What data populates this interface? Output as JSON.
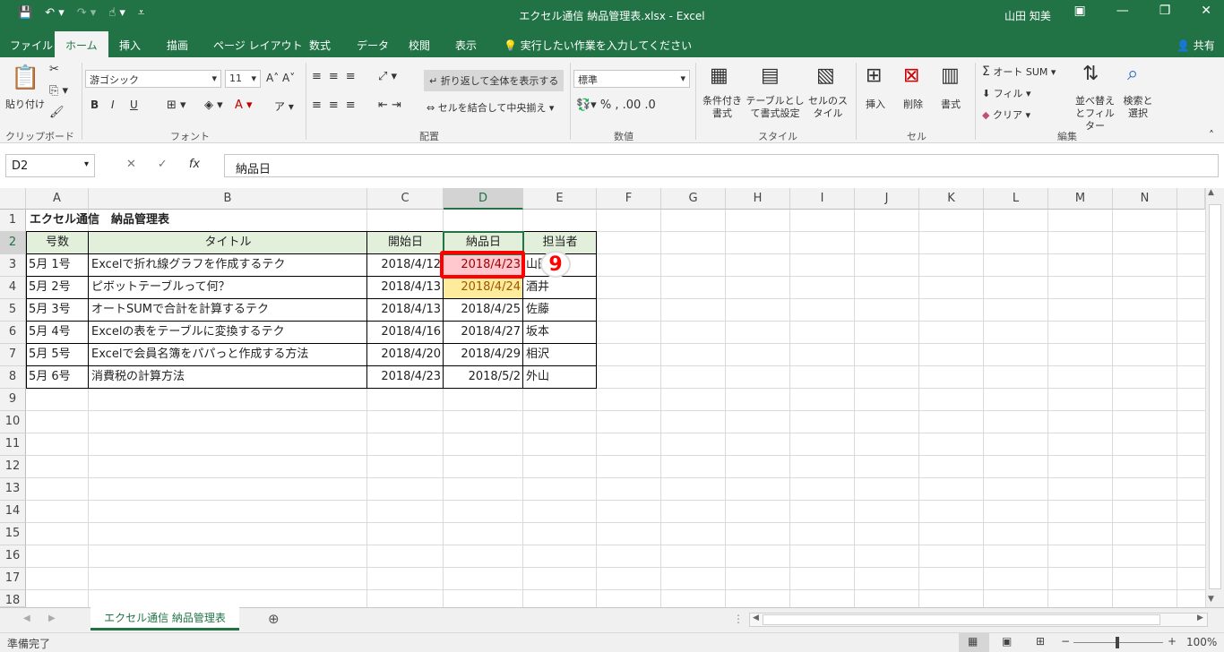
{
  "window": {
    "title": "エクセル通信 納品管理表.xlsx  -  Excel",
    "user": "山田 知美"
  },
  "tabs": [
    "ファイル",
    "ホーム",
    "挿入",
    "描画",
    "ページ レイアウト",
    "数式",
    "データ",
    "校閲",
    "表示",
    "実行したい作業を入力してください"
  ],
  "active_tab": "ホーム",
  "share_label": "共有",
  "ribbon": {
    "clipboard": {
      "paste": "貼り付け",
      "group": "クリップボード"
    },
    "font": {
      "name": "游ゴシック",
      "size": "11",
      "bold": "B",
      "italic": "I",
      "underline": "U",
      "group": "フォント"
    },
    "alignment": {
      "wrap": "折り返して全体を表示する",
      "merge": "セルを結合して中央揃え",
      "group": "配置"
    },
    "number": {
      "format": "標準",
      "group": "数値"
    },
    "styles": {
      "cond": "条件付き書式",
      "table": "テーブルとして書式設定",
      "cell": "セルのスタイル",
      "group": "スタイル"
    },
    "cells": {
      "insert": "挿入",
      "delete": "削除",
      "format": "書式",
      "group": "セル"
    },
    "editing": {
      "autosum": "オート SUM",
      "fill": "フィル",
      "clear": "クリア",
      "sort": "並べ替えとフィルター",
      "find": "検索と選択",
      "group": "編集"
    }
  },
  "formula_bar": {
    "name_box": "D2",
    "formula": "納品日"
  },
  "columns": [
    "A",
    "B",
    "C",
    "D",
    "E",
    "F",
    "G",
    "H",
    "I",
    "J",
    "K",
    "L",
    "M",
    "N"
  ],
  "rows": [
    "1",
    "2",
    "3",
    "4",
    "5",
    "6",
    "7",
    "8",
    "9",
    "10",
    "11",
    "12",
    "13",
    "14",
    "15",
    "16",
    "17",
    "18"
  ],
  "sheet": {
    "title": "エクセル通信　納品管理表",
    "headers": [
      "号数",
      "タイトル",
      "開始日",
      "納品日",
      "担当者"
    ],
    "data": [
      [
        "5月 1号",
        "Excelで折れ線グラフを作成するテク",
        "2018/4/12",
        "2018/4/23",
        "山田"
      ],
      [
        "5月 2号",
        "ピボットテーブルって何？",
        "2018/4/13",
        "2018/4/24",
        "酒井"
      ],
      [
        "5月 3号",
        "オートSUMで合計を計算するテク",
        "2018/4/13",
        "2018/4/25",
        "佐藤"
      ],
      [
        "5月 4号",
        "Excelの表をテーブルに変換するテク",
        "2018/4/16",
        "2018/4/27",
        "坂本"
      ],
      [
        "5月 5号",
        "Excelで会員名簿をパパっと作成する方法",
        "2018/4/20",
        "2018/4/29",
        "相沢"
      ],
      [
        "5月 6号",
        "消費税の計算方法",
        "2018/4/23",
        "2018/5/2",
        "外山"
      ]
    ]
  },
  "annotation": {
    "step": "9"
  },
  "sheet_tab": "エクセル通信  納品管理表",
  "status": {
    "ready": "準備完了",
    "zoom": "100%"
  },
  "colors": {
    "accent": "#217346",
    "header_fill": "#e2efda",
    "highlight_red": "#ffc7ce",
    "highlight_yellow": "#ffeb9c",
    "callout": "#ff0000"
  }
}
